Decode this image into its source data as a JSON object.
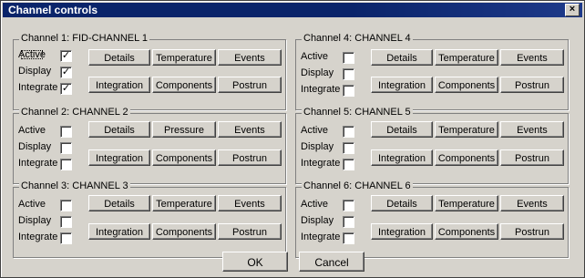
{
  "window": {
    "title": "Channel controls",
    "close_glyph": "×"
  },
  "labels": {
    "active": "Active",
    "display": "Display",
    "integrate": "Integrate"
  },
  "channels": [
    {
      "legend": "Channel 1: FID-CHANNEL 1",
      "active": true,
      "display": true,
      "integrate": true,
      "buttons": [
        "Details",
        "Temperature",
        "Events",
        "Integration",
        "Components",
        "Postrun"
      ]
    },
    {
      "legend": "Channel 2: CHANNEL 2",
      "active": false,
      "display": false,
      "integrate": false,
      "buttons": [
        "Details",
        "Pressure",
        "Events",
        "Integration",
        "Components",
        "Postrun"
      ]
    },
    {
      "legend": "Channel 3: CHANNEL 3",
      "active": false,
      "display": false,
      "integrate": false,
      "buttons": [
        "Details",
        "Temperature",
        "Events",
        "Integration",
        "Components",
        "Postrun"
      ]
    },
    {
      "legend": "Channel 4: CHANNEL 4",
      "active": false,
      "display": false,
      "integrate": false,
      "buttons": [
        "Details",
        "Temperature",
        "Events",
        "Integration",
        "Components",
        "Postrun"
      ]
    },
    {
      "legend": "Channel 5: CHANNEL 5",
      "active": false,
      "display": false,
      "integrate": false,
      "buttons": [
        "Details",
        "Temperature",
        "Events",
        "Integration",
        "Components",
        "Postrun"
      ]
    },
    {
      "legend": "Channel 6: CHANNEL 6",
      "active": false,
      "display": false,
      "integrate": false,
      "buttons": [
        "Details",
        "Temperature",
        "Events",
        "Integration",
        "Components",
        "Postrun"
      ]
    }
  ],
  "footer": {
    "ok_label": "OK",
    "cancel_label": "Cancel"
  },
  "colors": {
    "titlebar": "#0a246a",
    "face": "#d6d3cc"
  }
}
